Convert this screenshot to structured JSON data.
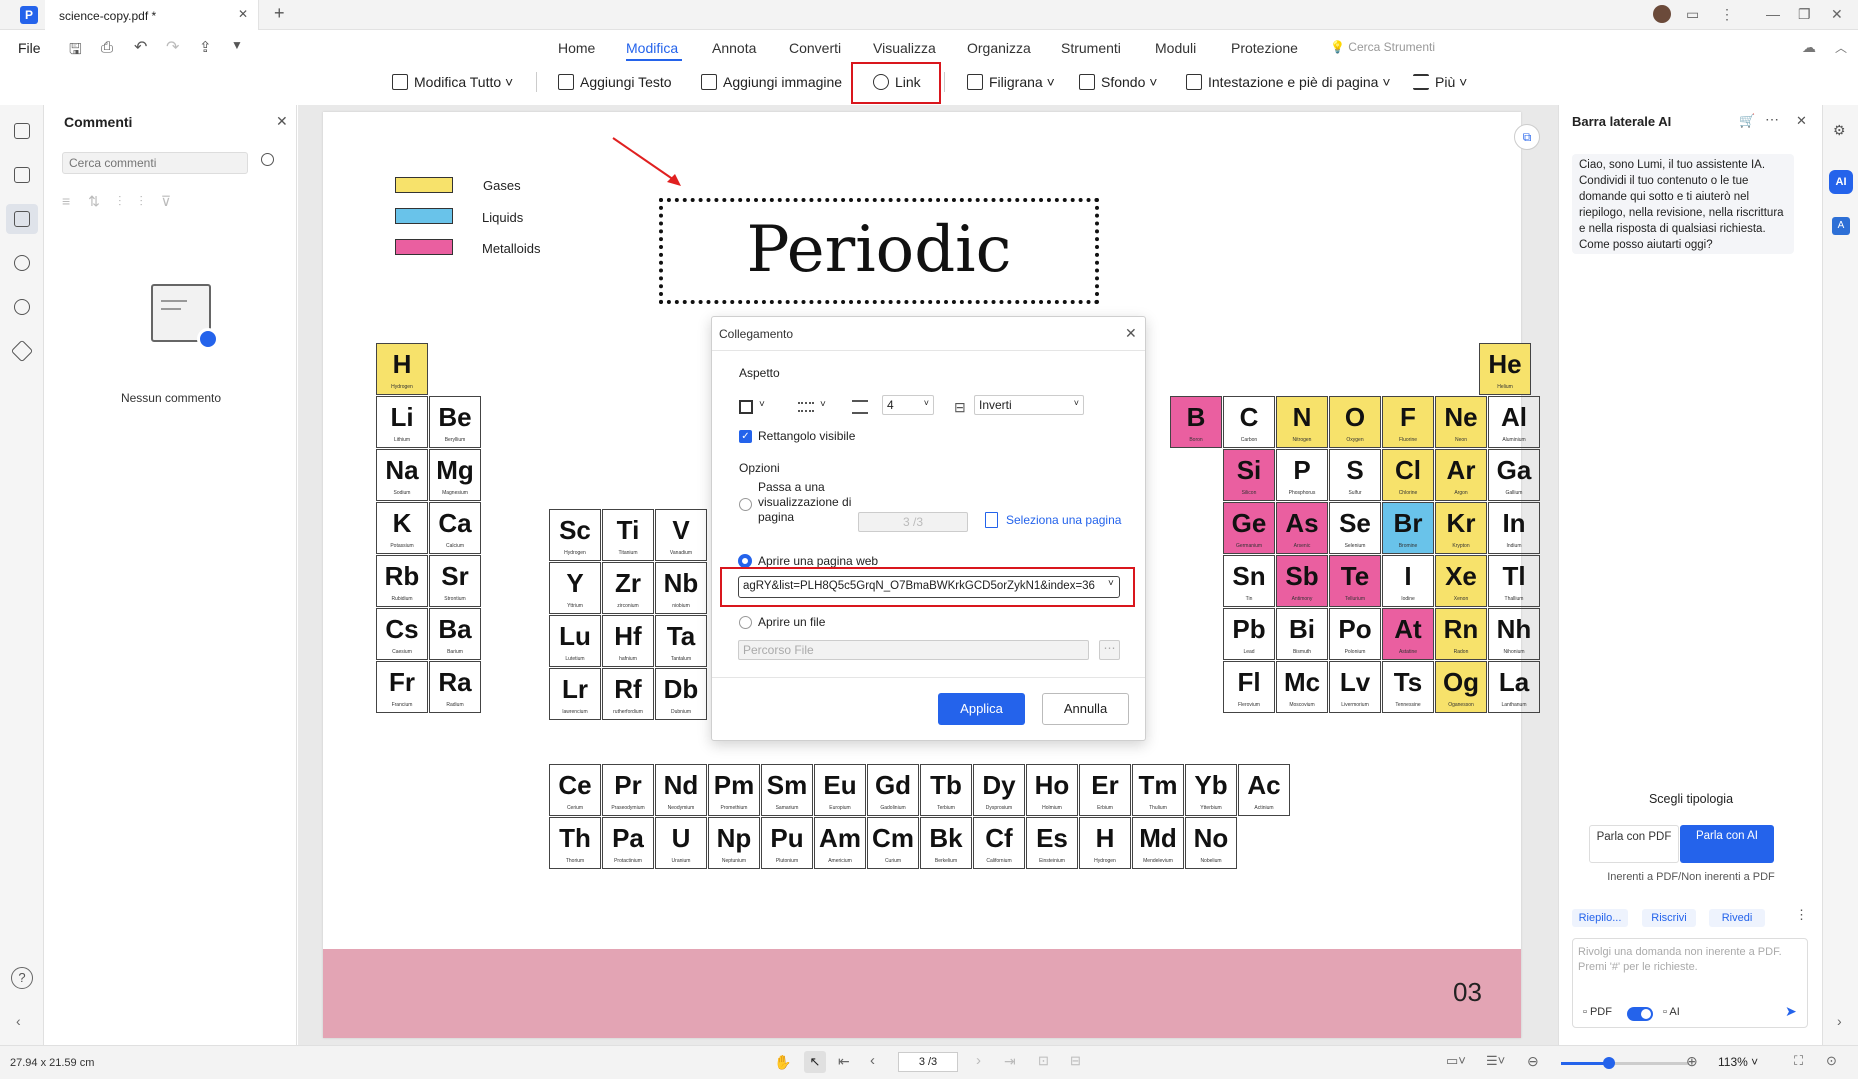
{
  "titlebar": {
    "doc_tab": "science-copy.pdf *",
    "new_tab": "+"
  },
  "menu": {
    "file": "File",
    "tabs": [
      "Home",
      "Modifica",
      "Annota",
      "Converti",
      "Visualizza",
      "Organizza",
      "Strumenti",
      "Moduli",
      "Protezione"
    ],
    "search_tools": "Cerca Strumenti"
  },
  "toolbar": {
    "edit_all": "Modifica Tutto",
    "add_text": "Aggiungi Testo",
    "add_image": "Aggiungi immagine",
    "link": "Link",
    "watermark": "Filigrana",
    "background": "Sfondo",
    "header_footer": "Intestazione e piè di pagina",
    "more": "Più"
  },
  "comments": {
    "title": "Commenti",
    "search_placeholder": "Cerca commenti",
    "empty": "Nessun commento"
  },
  "document": {
    "title": "Periodic Table",
    "legend": [
      {
        "label": "Gases",
        "color": "#f7e26b"
      },
      {
        "label": "Liquids",
        "color": "#69c3ea"
      },
      {
        "label": "Metalloids",
        "color": "#ea5fa0"
      }
    ],
    "page_number": "03",
    "elements": [
      {
        "s": "H",
        "n": "Hydrogen",
        "c": "yellow"
      },
      {
        "s": "Li",
        "n": "Lithium"
      },
      {
        "s": "Be",
        "n": "Beryllium"
      },
      {
        "s": "Na",
        "n": "Sodium"
      },
      {
        "s": "Mg",
        "n": "Magnesium"
      },
      {
        "s": "K",
        "n": "Potassium"
      },
      {
        "s": "Ca",
        "n": "Calcium"
      },
      {
        "s": "Rb",
        "n": "Rubidium"
      },
      {
        "s": "Sr",
        "n": "Strontium"
      },
      {
        "s": "Cs",
        "n": "Caesium"
      },
      {
        "s": "Ba",
        "n": "Barium"
      },
      {
        "s": "Fr",
        "n": "Francium"
      },
      {
        "s": "Ra",
        "n": "Radium"
      },
      {
        "s": "Sc",
        "n": "Hydrogen"
      },
      {
        "s": "Ti",
        "n": "Titanium"
      },
      {
        "s": "V",
        "n": "Vanadium"
      },
      {
        "s": "Y",
        "n": "Yttrium"
      },
      {
        "s": "Zr",
        "n": "zirconium"
      },
      {
        "s": "Nb",
        "n": "niobium"
      },
      {
        "s": "Lu",
        "n": "Lutetium"
      },
      {
        "s": "Hf",
        "n": "hafnium"
      },
      {
        "s": "Ta",
        "n": "Tantalum"
      },
      {
        "s": "Lr",
        "n": "lawrencium"
      },
      {
        "s": "Rf",
        "n": "rutherfordium"
      },
      {
        "s": "Db",
        "n": "Dubnium"
      },
      {
        "s": "He",
        "n": "Helium",
        "c": "yellow"
      },
      {
        "s": "B",
        "n": "Boron",
        "c": "pink"
      },
      {
        "s": "C",
        "n": "Carbon"
      },
      {
        "s": "N",
        "n": "Nitrogen",
        "c": "yellow"
      },
      {
        "s": "O",
        "n": "Oxygen",
        "c": "yellow"
      },
      {
        "s": "F",
        "n": "Fluorine",
        "c": "yellow"
      },
      {
        "s": "Ne",
        "n": "Neon",
        "c": "yellow"
      },
      {
        "s": "Al",
        "n": "Aluminium"
      },
      {
        "s": "Si",
        "n": "Silicon",
        "c": "pink"
      },
      {
        "s": "P",
        "n": "Phosphorus"
      },
      {
        "s": "S",
        "n": "Sulfur"
      },
      {
        "s": "Cl",
        "n": "Chlorine",
        "c": "yellow"
      },
      {
        "s": "Ar",
        "n": "Argon",
        "c": "yellow"
      },
      {
        "s": "Ga",
        "n": "Gallium"
      },
      {
        "s": "Ge",
        "n": "Germanium",
        "c": "pink"
      },
      {
        "s": "As",
        "n": "Arsenic",
        "c": "pink"
      },
      {
        "s": "Se",
        "n": "Selenium"
      },
      {
        "s": "Br",
        "n": "Bromine",
        "c": "blue"
      },
      {
        "s": "Kr",
        "n": "Krypton",
        "c": "yellow"
      },
      {
        "s": "In",
        "n": "Indium"
      },
      {
        "s": "Sn",
        "n": "Tin"
      },
      {
        "s": "Sb",
        "n": "Antimony",
        "c": "pink"
      },
      {
        "s": "Te",
        "n": "Tellurium",
        "c": "pink"
      },
      {
        "s": "I",
        "n": "Iodine"
      },
      {
        "s": "Xe",
        "n": "Xenon",
        "c": "yellow"
      },
      {
        "s": "Tl",
        "n": "Thallium"
      },
      {
        "s": "Pb",
        "n": "Lead"
      },
      {
        "s": "Bi",
        "n": "Bismuth"
      },
      {
        "s": "Po",
        "n": "Polonium"
      },
      {
        "s": "At",
        "n": "Astatine",
        "c": "pink"
      },
      {
        "s": "Rn",
        "n": "Radon",
        "c": "yellow"
      },
      {
        "s": "Nh",
        "n": "Nihonium"
      },
      {
        "s": "Fl",
        "n": "Flerovium"
      },
      {
        "s": "Mc",
        "n": "Moscovium"
      },
      {
        "s": "Lv",
        "n": "Livermorium"
      },
      {
        "s": "Ts",
        "n": "Tennessine"
      },
      {
        "s": "Og",
        "n": "Oganesson",
        "c": "yellow"
      },
      {
        "s": "La",
        "n": "Lanthanum"
      },
      {
        "s": "Ce",
        "n": "Cerium"
      },
      {
        "s": "Pr",
        "n": "Praseodymium"
      },
      {
        "s": "Nd",
        "n": "Neodymium"
      },
      {
        "s": "Pm",
        "n": "Promethium"
      },
      {
        "s": "Sm",
        "n": "Samarium"
      },
      {
        "s": "Eu",
        "n": "Europium"
      },
      {
        "s": "Gd",
        "n": "Gadolinium"
      },
      {
        "s": "Tb",
        "n": "Terbium"
      },
      {
        "s": "Dy",
        "n": "Dysprosium"
      },
      {
        "s": "Ho",
        "n": "Holmium"
      },
      {
        "s": "Er",
        "n": "Erbium"
      },
      {
        "s": "Tm",
        "n": "Thulium"
      },
      {
        "s": "Yb",
        "n": "Ytterbium"
      },
      {
        "s": "Ac",
        "n": "Actinium"
      },
      {
        "s": "Th",
        "n": "Thorium"
      },
      {
        "s": "Pa",
        "n": "Protactinium"
      },
      {
        "s": "U",
        "n": "Uranium"
      },
      {
        "s": "Np",
        "n": "Neptunium"
      },
      {
        "s": "Pu",
        "n": "Plutonium"
      },
      {
        "s": "Am",
        "n": "Americium"
      },
      {
        "s": "Cm",
        "n": "Curium"
      },
      {
        "s": "Bk",
        "n": "Berkelium"
      },
      {
        "s": "Cf",
        "n": "Californium"
      },
      {
        "s": "Es",
        "n": "Einsteinium"
      },
      {
        "s": "H",
        "n": "Hydrogen"
      },
      {
        "s": "Md",
        "n": "Mendelevium"
      },
      {
        "s": "No",
        "n": "Nobelium"
      }
    ]
  },
  "cell_colors": {
    "yellow": "#f7e26b",
    "pink": "#ea5fa0",
    "blue": "#69c3ea"
  },
  "dialog": {
    "title": "Collegamento",
    "appearance": "Aspetto",
    "thickness": "4",
    "highlight": "Inverti",
    "visible_rect": "Rettangolo visibile",
    "options": "Opzioni",
    "goto_page": "Passa a una visualizzazione di pagina",
    "page_field": "3 /3",
    "select_page": "Seleziona una pagina",
    "open_web": "Aprire una pagina web",
    "url": "agRY&list=PLH8Q5c5GrqN_O7BmaBWKrkGCD5orZykN1&index=36",
    "open_file": "Aprire un file",
    "file_placeholder": "Percorso File",
    "apply": "Applica",
    "cancel": "Annulla"
  },
  "ai": {
    "title": "Barra laterale AI",
    "message": "Ciao, sono Lumi, il tuo assistente IA. Condividi il tuo contenuto o le tue domande qui sotto e ti aiuterò nel riepilogo, nella revisione, nella riscrittura e nella risposta di qualsiasi richiesta. Come posso aiutarti oggi?",
    "choose_type": "Scegli tipologia",
    "talk_pdf": "Parla con PDF",
    "talk_ai": "Parla con AI",
    "inherent": "Inerenti a PDF/Non inerenti a PDF",
    "chips": [
      "Riepilo...",
      "Riscrivi",
      "Rivedi"
    ],
    "input_placeholder": "Rivolgi una domanda non inerente a PDF. Premi '#' per le richieste.",
    "toggle_pdf": "PDF",
    "toggle_ai": "AI"
  },
  "status": {
    "size": "27.94 x 21.59 cm",
    "page": "3 /3",
    "zoom": "113%"
  }
}
